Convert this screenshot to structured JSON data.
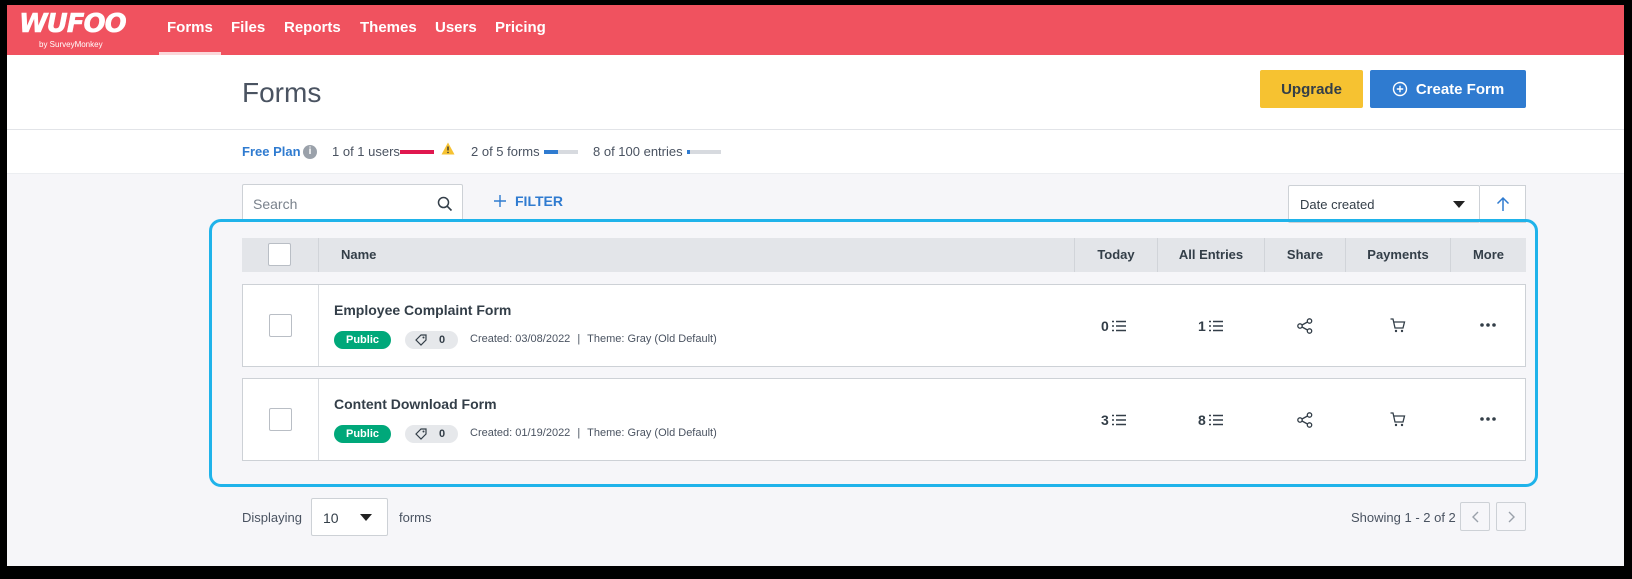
{
  "brand": {
    "name": "WUFOO",
    "sub": "by SurveyMonkey"
  },
  "nav": {
    "items": [
      {
        "label": "Forms",
        "active": true
      },
      {
        "label": "Files",
        "active": false
      },
      {
        "label": "Reports",
        "active": false
      },
      {
        "label": "Themes",
        "active": false
      },
      {
        "label": "Users",
        "active": false
      },
      {
        "label": "Pricing",
        "active": false
      }
    ]
  },
  "header": {
    "title": "Forms",
    "upgrade_label": "Upgrade",
    "create_label": "Create Form"
  },
  "plan": {
    "name": "Free Plan",
    "users": {
      "text": "1 of 1 users",
      "fraction": 1.0
    },
    "forms": {
      "text": "2 of 5 forms",
      "fraction": 0.4
    },
    "entries": {
      "text": "8 of 100 entries",
      "fraction": 0.08
    }
  },
  "toolbar": {
    "search_placeholder": "Search",
    "filter_label": "FILTER",
    "sort_value": "Date created"
  },
  "table": {
    "headers": {
      "name": "Name",
      "today": "Today",
      "all_entries": "All Entries",
      "share": "Share",
      "payments": "Payments",
      "more": "More"
    },
    "rows": [
      {
        "name": "Employee Complaint Form",
        "status": "Public",
        "tags": "0",
        "created": "Created: 03/08/2022",
        "theme": "Theme: Gray (Old Default)",
        "today": "0",
        "all_entries": "1"
      },
      {
        "name": "Content Download Form",
        "status": "Public",
        "tags": "0",
        "created": "Created: 01/19/2022",
        "theme": "Theme: Gray (Old Default)",
        "today": "3",
        "all_entries": "8"
      }
    ]
  },
  "footer": {
    "displaying_label": "Displaying",
    "per_page": "10",
    "forms_label": "forms",
    "showing_text": "Showing 1 - 2 of 2"
  },
  "colors": {
    "brand": "#f0525f",
    "primary": "#2f7bd0",
    "upgrade": "#f6c231",
    "public_badge": "#00a87a",
    "highlight": "#1fb3ea"
  }
}
